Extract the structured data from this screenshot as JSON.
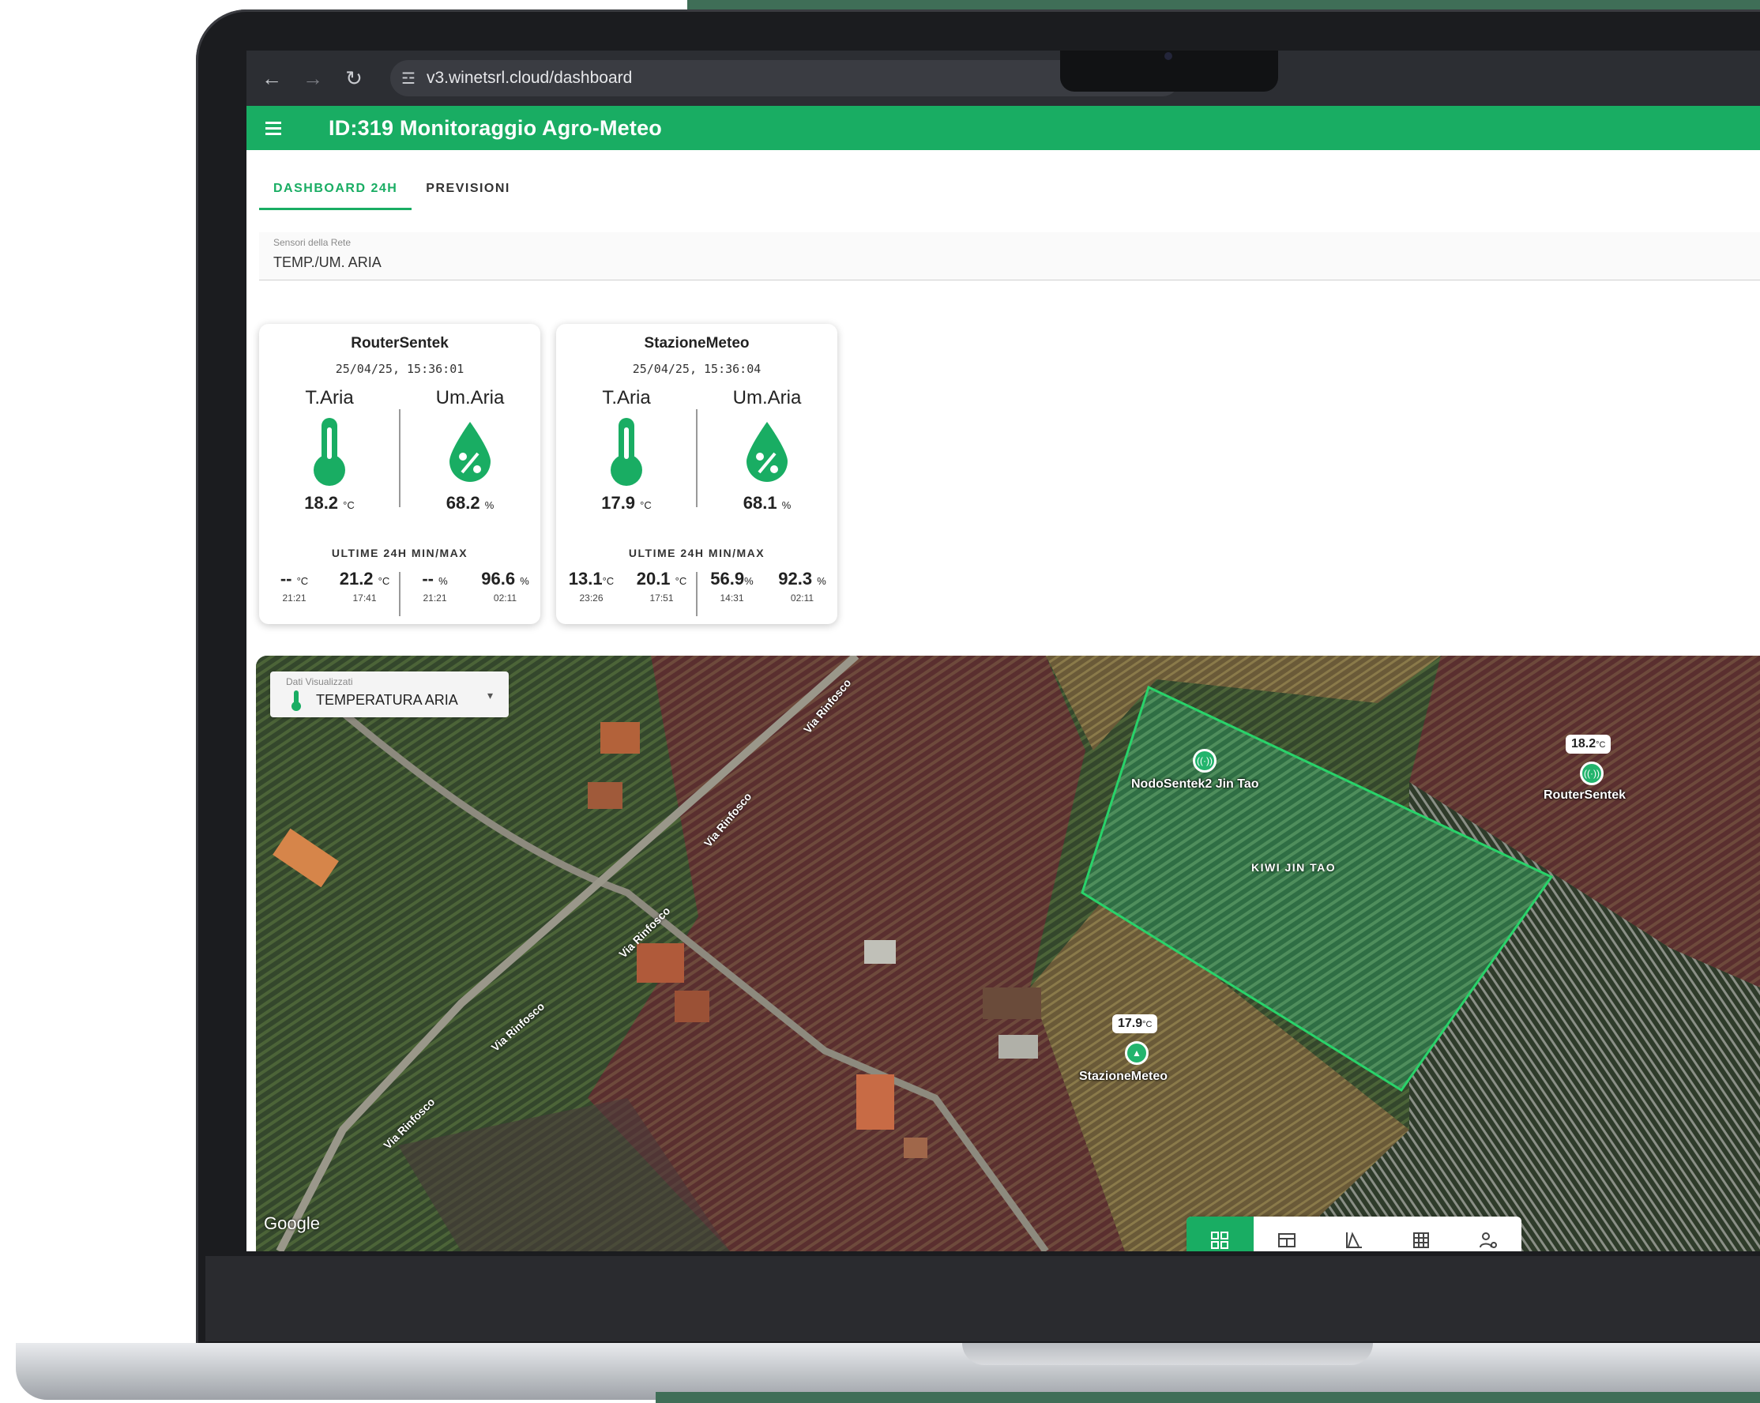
{
  "browser": {
    "url": "v3.winetsrl.cloud/dashboard",
    "back_icon": "←",
    "forward_icon": "→",
    "reload_icon": "↻",
    "tune_icon": "☲"
  },
  "app": {
    "title": "ID:319 Monitoraggio Agro-Meteo",
    "accent": "#19ad63"
  },
  "tabs": [
    {
      "label": "DASHBOARD 24H",
      "active": true
    },
    {
      "label": "PREVISIONI",
      "active": false
    }
  ],
  "sensor_select": {
    "label": "Sensori della Rete",
    "value": "TEMP./UM. ARIA"
  },
  "cards": [
    {
      "name": "RouterSentek",
      "timestamp": "25/04/25, 15:36:01",
      "temp_label": "T.Aria",
      "hum_label": "Um.Aria",
      "temp_value": "18.2",
      "temp_unit": "°C",
      "hum_value": "68.2",
      "hum_unit": "%",
      "minmax_title": "ULTIME 24H MIN/MAX",
      "minmax": [
        {
          "value": "--",
          "unit": "°C",
          "time": "21:21"
        },
        {
          "value": "21.2",
          "unit": "°C",
          "time": "17:41"
        },
        {
          "value": "--",
          "unit": "%",
          "time": "21:21"
        },
        {
          "value": "96.6",
          "unit": "%",
          "time": "02:11"
        }
      ]
    },
    {
      "name": "StazioneMeteo",
      "timestamp": "25/04/25, 15:36:04",
      "temp_label": "T.Aria",
      "hum_label": "Um.Aria",
      "temp_value": "17.9",
      "temp_unit": "°C",
      "hum_value": "68.1",
      "hum_unit": "%",
      "minmax_title": "ULTIME 24H MIN/MAX",
      "minmax": [
        {
          "value": "13.1",
          "unit": "°C",
          "time": "23:26"
        },
        {
          "value": "20.1",
          "unit": "°C",
          "time": "17:51"
        },
        {
          "value": "56.9",
          "unit": "%",
          "time": "14:31"
        },
        {
          "value": "92.3",
          "unit": "%",
          "time": "02:11"
        }
      ]
    }
  ],
  "map": {
    "data_select_label": "Dati Visualizzati",
    "data_select_value": "TEMPERATURA ARIA",
    "dropdown_icon": "▾",
    "road_name": "Via Rinfosco",
    "field_name": "KIWI JIN TAO",
    "attribution": "Google",
    "nodes": [
      {
        "name": "NodoSentek2 Jin Tao",
        "temp": ""
      },
      {
        "name": "RouterSentek",
        "temp": "18.2",
        "unit": "°C"
      },
      {
        "name": "StazioneMeteo",
        "temp": "17.9",
        "unit": "°C"
      }
    ]
  },
  "view_bar": [
    {
      "icon": "dashboard-icon",
      "active": true
    },
    {
      "icon": "table-icon",
      "active": false
    },
    {
      "icon": "chart-icon",
      "active": false
    },
    {
      "icon": "grid-icon",
      "active": false
    },
    {
      "icon": "user-settings-icon",
      "active": false
    }
  ]
}
